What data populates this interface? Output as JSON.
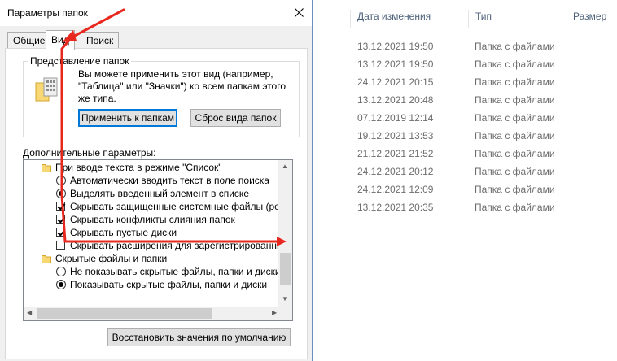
{
  "explorer": {
    "columns": {
      "date": "Дата изменения",
      "type": "Тип",
      "size": "Размер"
    },
    "rows": [
      {
        "date": "13.12.2021 19:50",
        "type": "Папка с файлами"
      },
      {
        "date": "13.12.2021 19:50",
        "type": "Папка с файлами"
      },
      {
        "date": "24.12.2021 20:15",
        "type": "Папка с файлами"
      },
      {
        "date": "13.12.2021 20:48",
        "type": "Папка с файлами"
      },
      {
        "date": "07.12.2019 12:14",
        "type": "Папка с файлами"
      },
      {
        "date": "19.12.2021 13:53",
        "type": "Папка с файлами"
      },
      {
        "date": "21.12.2021 21:52",
        "type": "Папка с файлами"
      },
      {
        "date": "24.12.2021 20:12",
        "type": "Папка с файлами"
      },
      {
        "date": "24.12.2021 12:09",
        "type": "Папка с файлами"
      },
      {
        "date": "13.12.2021 20:35",
        "type": "Папка с файлами"
      }
    ]
  },
  "dialog": {
    "title": "Параметры папок",
    "close_icon": "close-icon",
    "tabs": {
      "general": "Общие",
      "view": "Вид",
      "search": "Поиск"
    },
    "folder_views": {
      "legend": "Представление папок",
      "description": "Вы можете применить этот вид (например, \"Таблица\" или \"Значки\") ко всем папкам этого же типа.",
      "apply_button": "Применить к папкам",
      "reset_button": "Сброс вида папок"
    },
    "advanced": {
      "label": "Дополнительные параметры:",
      "items": [
        {
          "kind": "folder",
          "label": "При вводе текста в режиме \"Список\""
        },
        {
          "kind": "radio",
          "checked": false,
          "label": "Автоматически вводить текст в поле поиска"
        },
        {
          "kind": "radio",
          "checked": true,
          "label": "Выделять введенный элемент в списке"
        },
        {
          "kind": "checkbox",
          "checked": true,
          "label": "Скрывать защищенные системные файлы (рекомен"
        },
        {
          "kind": "checkbox",
          "checked": true,
          "label": "Скрывать конфликты слияния папок"
        },
        {
          "kind": "checkbox",
          "checked": true,
          "label": "Скрывать пустые диски"
        },
        {
          "kind": "checkbox",
          "checked": false,
          "label": "Скрывать расширения для зарегистрированных типо"
        },
        {
          "kind": "folder",
          "label": "Скрытые файлы и папки"
        },
        {
          "kind": "radio",
          "checked": false,
          "label": "Не показывать скрытые файлы, папки и диски"
        },
        {
          "kind": "radio",
          "checked": true,
          "label": "Показывать скрытые файлы, папки и диски"
        }
      ]
    },
    "restore_button": "Восстановить значения по умолчанию"
  },
  "annotation": {
    "color": "#e8281e"
  }
}
